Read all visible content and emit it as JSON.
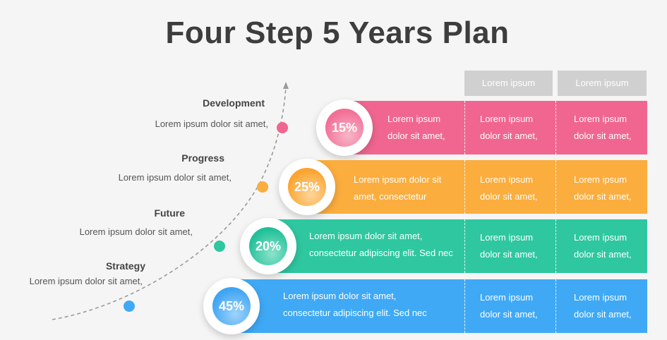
{
  "title": "Four Step 5 Years Plan",
  "columns": [
    {
      "label": "Lorem ipsum"
    },
    {
      "label": "Lorem ipsum"
    }
  ],
  "steps": [
    {
      "name": "Development",
      "description": "Lorem ipsum dolor sit amet,",
      "percent": "15%",
      "color": "#f06690",
      "circle_gradient": [
        "#f26f97",
        "#f7b6c8"
      ],
      "main_text": [
        "Lorem ipsum",
        "dolor sit amet,"
      ],
      "cells": [
        [
          "Lorem ipsum",
          "dolor sit amet,"
        ],
        [
          "Lorem ipsum",
          "dolor sit amet,"
        ]
      ]
    },
    {
      "name": "Progress",
      "description": "Lorem ipsum dolor sit amet,",
      "percent": "25%",
      "color": "#fbad3e",
      "circle_gradient": [
        "#fba42f",
        "#fdd59a"
      ],
      "main_text": [
        "Lorem ipsum dolor sit",
        "amet, consectetur"
      ],
      "cells": [
        [
          "Lorem ipsum",
          "dolor sit amet,"
        ],
        [
          "Lorem ipsum",
          "dolor sit amet,"
        ]
      ]
    },
    {
      "name": "Future",
      "description": "Lorem ipsum dolor sit amet,",
      "percent": "20%",
      "color": "#2ec7a0",
      "circle_gradient": [
        "#22c099",
        "#8be3cb"
      ],
      "main_text": [
        "Lorem ipsum dolor sit amet,",
        "consectetur adipiscing elit. Sed nec"
      ],
      "cells": [
        [
          "Lorem ipsum",
          "dolor sit amet,"
        ],
        [
          "Lorem ipsum",
          "dolor sit amet,"
        ]
      ]
    },
    {
      "name": "Strategy",
      "description": "Lorem ipsum dolor sit amet,",
      "percent": "45%",
      "color": "#3fa9f5",
      "circle_gradient": [
        "#3fa4f2",
        "#9fd3fa"
      ],
      "main_text": [
        "Lorem ipsum dolor sit amet,",
        "consectetur adipiscing elit. Sed nec"
      ],
      "cells": [
        [
          "Lorem ipsum",
          "dolor sit amet,"
        ],
        [
          "Lorem ipsum",
          "dolor sit amet,"
        ]
      ]
    }
  ]
}
